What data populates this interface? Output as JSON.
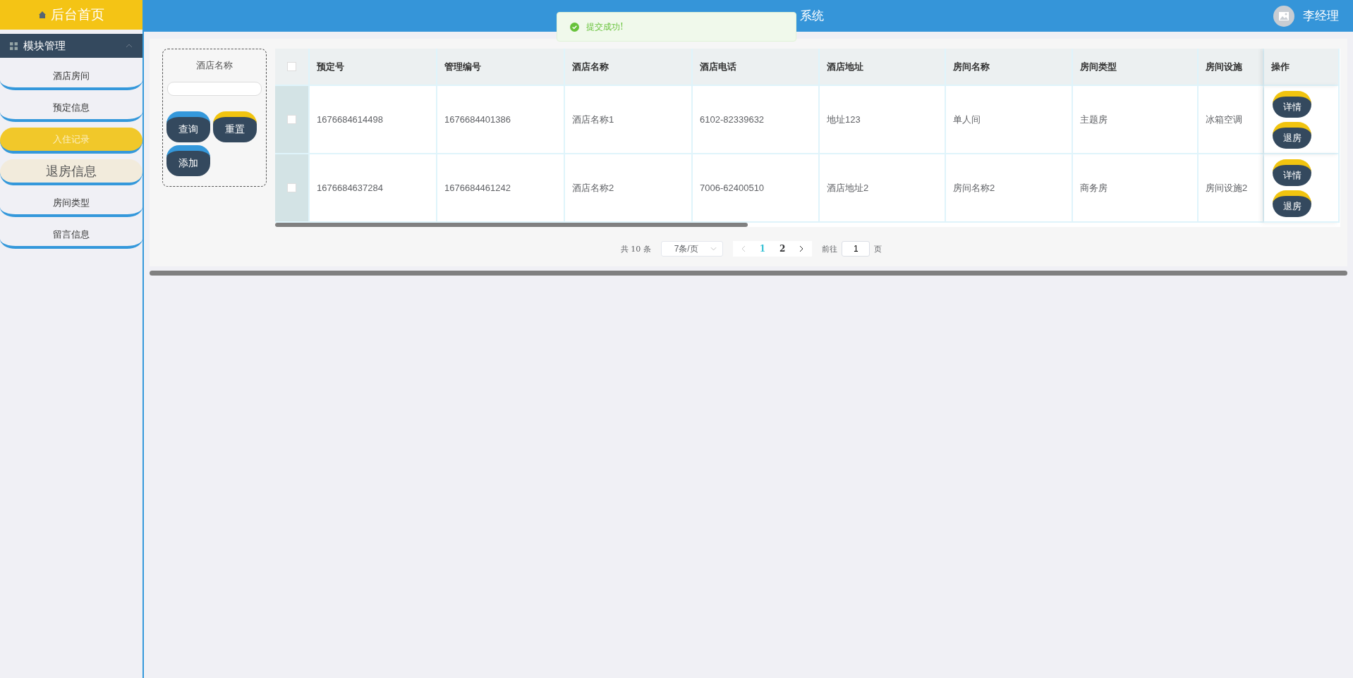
{
  "sidebar": {
    "home": "后台首页",
    "section": {
      "label": "模块管理",
      "expanded": true
    },
    "items": [
      {
        "label": "酒店房间",
        "selected": false,
        "hovered": false
      },
      {
        "label": "预定信息",
        "selected": false,
        "hovered": false
      },
      {
        "label": "入住记录",
        "selected": true,
        "hovered": false
      },
      {
        "label": "退房信息",
        "selected": false,
        "hovered": true
      },
      {
        "label": "房间类型",
        "selected": false,
        "hovered": false
      },
      {
        "label": "留言信息",
        "selected": false,
        "hovered": false
      }
    ]
  },
  "header": {
    "title": "系统",
    "user": "李经理"
  },
  "toast": {
    "message": "提交成功!"
  },
  "search": {
    "label": "酒店名称",
    "buttons": [
      {
        "label": "查询",
        "color": "#3498db"
      },
      {
        "label": "重置",
        "color": "#f1c40f"
      },
      {
        "label": "添加",
        "color": "#3498db"
      }
    ]
  },
  "table": {
    "all_checked": false,
    "columns": [
      "预定号",
      "管理编号",
      "酒店名称",
      "酒店电话",
      "酒店地址",
      "房间名称",
      "房间类型",
      "房间设施",
      "操作"
    ],
    "rows": [
      {
        "checked": false,
        "cells": [
          "1676684614498",
          "1676684401386",
          "酒店名称1",
          "6102-82339632",
          "地址123",
          "单人间",
          "主题房",
          "冰箱空调"
        ],
        "actions": [
          "详情",
          "退房"
        ]
      },
      {
        "checked": false,
        "cells": [
          "1676684637284",
          "1676684461242",
          "酒店名称2",
          "7006-62400510",
          "酒店地址2",
          "房间名称2",
          "商务房",
          "房间设施2"
        ],
        "actions": [
          "详情",
          "退房"
        ]
      }
    ]
  },
  "pagination": {
    "total": "共 10 条",
    "page_size": "7条/页",
    "pages": [
      {
        "label": "1",
        "selected": true
      },
      {
        "label": "2",
        "selected": false
      }
    ],
    "goto_label": "前往",
    "goto_value": "1",
    "goto_suffix": "页"
  }
}
